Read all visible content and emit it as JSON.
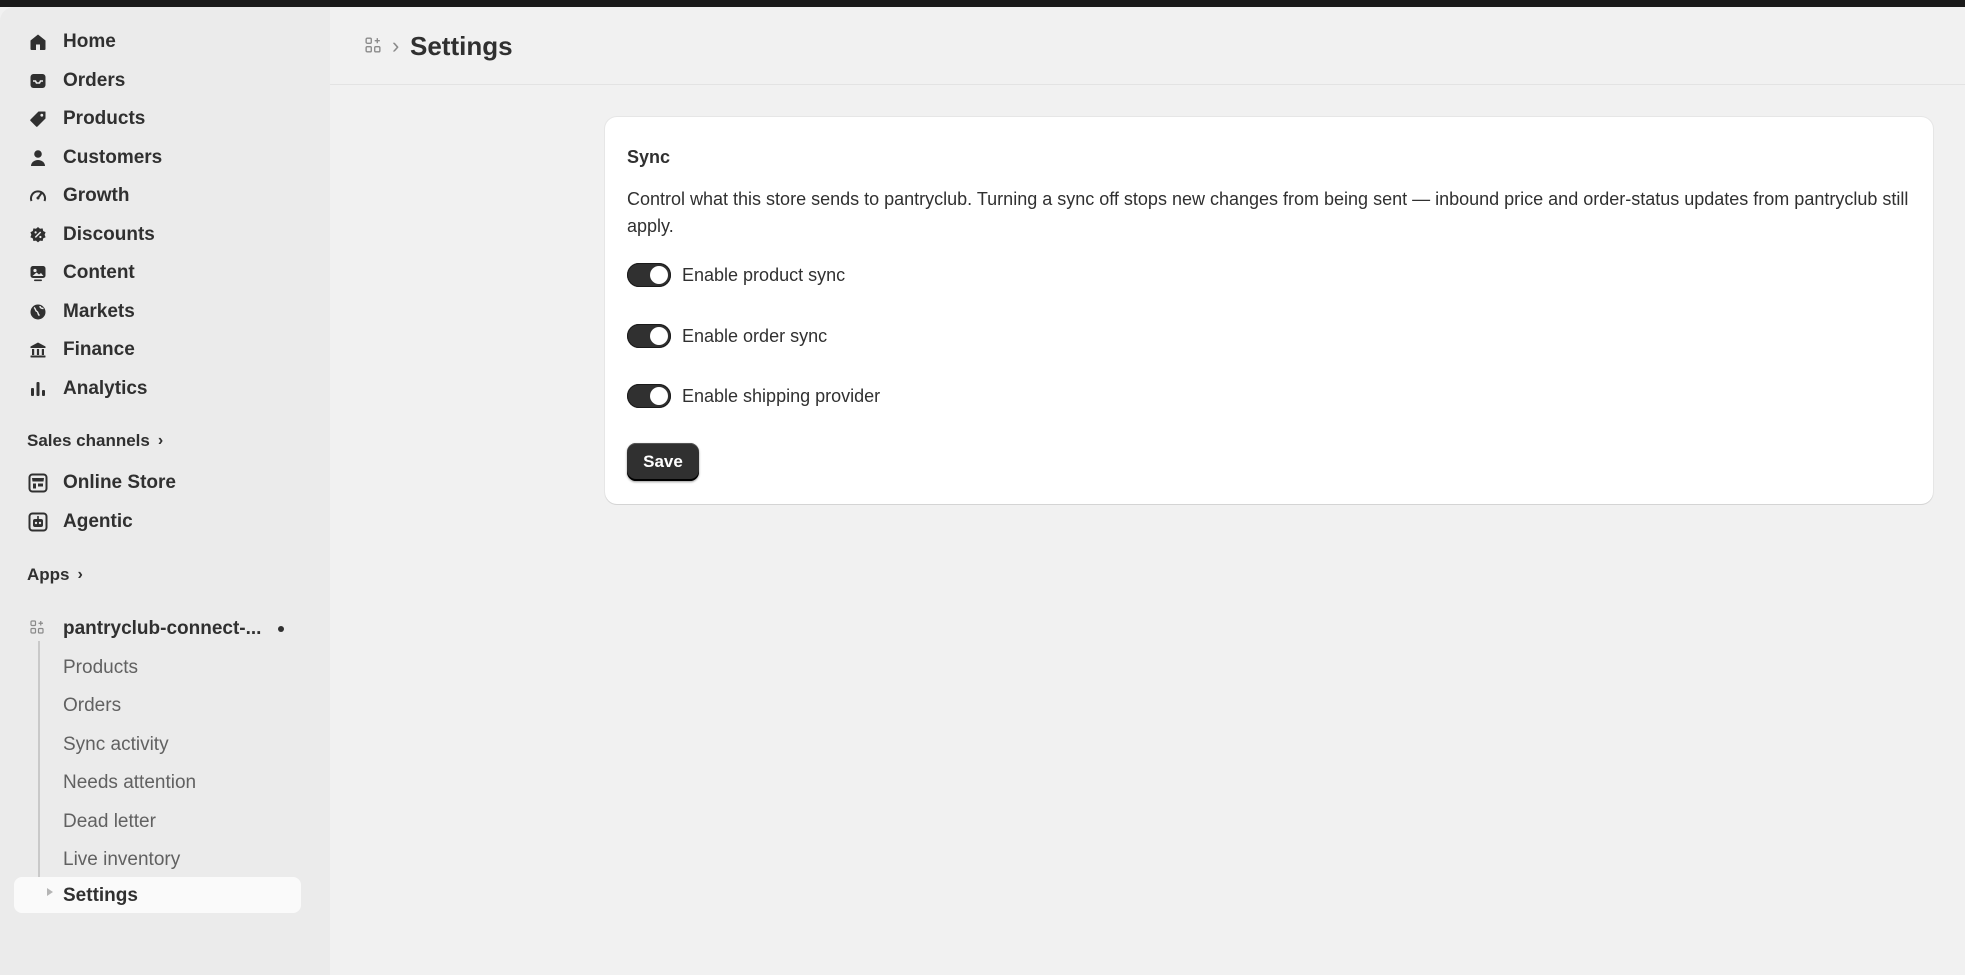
{
  "sidebar": {
    "nav": [
      {
        "label": "Home",
        "icon": "home-icon"
      },
      {
        "label": "Orders",
        "icon": "inbox-icon"
      },
      {
        "label": "Products",
        "icon": "tag-icon"
      },
      {
        "label": "Customers",
        "icon": "person-icon"
      },
      {
        "label": "Growth",
        "icon": "gauge-icon"
      },
      {
        "label": "Discounts",
        "icon": "discount-icon"
      },
      {
        "label": "Content",
        "icon": "content-icon"
      },
      {
        "label": "Markets",
        "icon": "globe-icon"
      },
      {
        "label": "Finance",
        "icon": "bank-icon"
      },
      {
        "label": "Analytics",
        "icon": "bar-chart-icon"
      }
    ],
    "sales_channels_heading": "Sales channels",
    "channels": [
      {
        "label": "Online Store",
        "icon": "store-icon"
      },
      {
        "label": "Agentic",
        "icon": "agentic-icon"
      }
    ],
    "apps_heading": "Apps",
    "app": {
      "label": "pantryclub-connect-...",
      "icon": "app-grid-icon",
      "subitems": [
        {
          "label": "Products"
        },
        {
          "label": "Orders"
        },
        {
          "label": "Sync activity"
        },
        {
          "label": "Needs attention"
        },
        {
          "label": "Dead letter"
        },
        {
          "label": "Live inventory"
        },
        {
          "label": "Settings",
          "active": true
        }
      ]
    }
  },
  "header": {
    "title": "Settings"
  },
  "card": {
    "title": "Sync",
    "description": "Control what this store sends to pantryclub. Turning a sync off stops new changes from being sent — inbound price and order-status updates from pantryclub still apply.",
    "toggles": [
      {
        "label": "Enable product sync",
        "on": true
      },
      {
        "label": "Enable order sync",
        "on": true
      },
      {
        "label": "Enable shipping provider",
        "on": true
      }
    ],
    "save_label": "Save"
  },
  "colors": {
    "sidebar_bg": "#ebebeb",
    "page_bg": "#f1f1f1",
    "text": "#303030",
    "muted_text": "#616161",
    "toggle_on": "#303030"
  }
}
